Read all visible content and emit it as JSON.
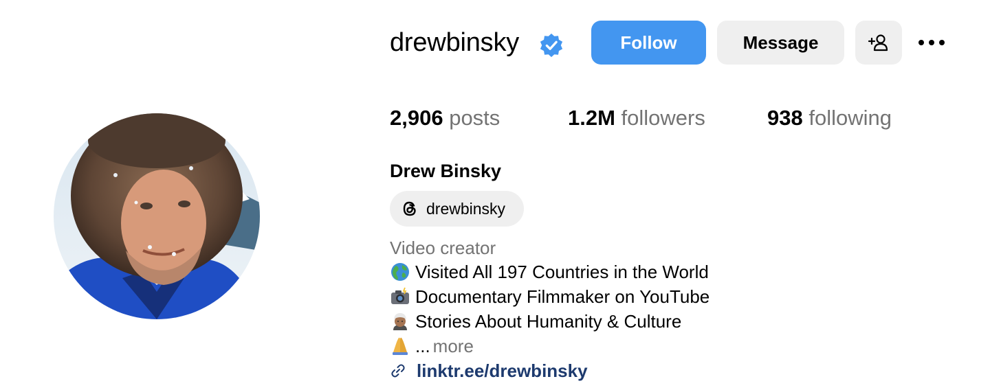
{
  "profile": {
    "username": "drewbinsky",
    "verified": true,
    "full_name": "Drew Binsky",
    "category": "Video creator",
    "avatar_alt": "profile-photo"
  },
  "actions": {
    "follow_label": "Follow",
    "message_label": "Message",
    "add_user_icon": "add-person-icon",
    "more_icon": "more-horizontal-icon"
  },
  "stats": [
    {
      "value": "2,906",
      "label": "posts"
    },
    {
      "value": "1.2M",
      "label": "followers"
    },
    {
      "value": "938",
      "label": "following"
    }
  ],
  "threads": {
    "icon": "threads-icon",
    "handle": "drewbinsky"
  },
  "bio": {
    "lines": [
      {
        "emoji": "globe-icon",
        "text": "Visited All 197 Countries in the World"
      },
      {
        "emoji": "camera-flash-icon",
        "text": "Documentary Filmmaker on YouTube"
      },
      {
        "emoji": "person-turban-icon",
        "text": "Stories About Humanity & Culture"
      },
      {
        "emoji": "folded-hands-icon",
        "text": "..."
      }
    ],
    "more_label": "more"
  },
  "link": {
    "icon": "link-icon",
    "text": "linktr.ee/drewbinsky"
  },
  "colors": {
    "follow_bg": "#4396f0",
    "secondary_bg": "#efefef",
    "muted_text": "#737373",
    "link_text": "#1d3a6e",
    "verified_badge": "#4396f0"
  }
}
